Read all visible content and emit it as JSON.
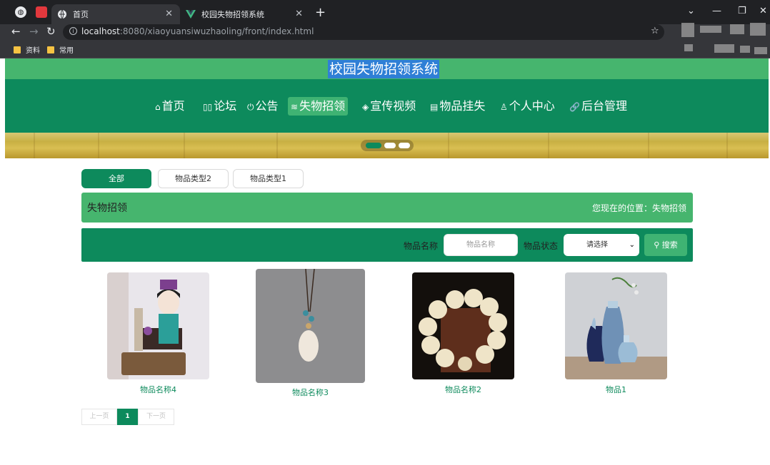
{
  "browser": {
    "tabs": [
      {
        "title": "首页",
        "active": true
      },
      {
        "title": "校园失物招领系统",
        "active": false
      }
    ],
    "url_host": "localhost",
    "url_rest": ":8080/xiaoyuansiwuzhaoling/front/index.html",
    "bookmarks": [
      "资料",
      "常用"
    ]
  },
  "site": {
    "title": "校园失物招领系统",
    "nav": [
      {
        "icon": "⌂",
        "label": "首页"
      },
      {
        "icon": "▯▯",
        "label": "论坛"
      },
      {
        "icon": "⏻",
        "label": "公告"
      },
      {
        "icon": "≋",
        "label": "失物招领"
      },
      {
        "icon": "◈",
        "label": "宣传视频"
      },
      {
        "icon": "▤",
        "label": "物品挂失"
      },
      {
        "icon": "♙",
        "label": "个人中心"
      },
      {
        "icon": "🔗",
        "label": "后台管理"
      }
    ],
    "active_nav": "失物招领"
  },
  "categories": [
    "全部",
    "物品类型2",
    "物品类型1"
  ],
  "breadcrumb": {
    "title": "失物招领",
    "position": "您现在的位置：失物招领"
  },
  "search": {
    "name_label": "物品名称",
    "name_placeholder": "物品名称",
    "status_label": "物品状态",
    "status_value": "请选择",
    "button_label": "搜索"
  },
  "items": [
    {
      "name": "物品名称4"
    },
    {
      "name": "物品名称3"
    },
    {
      "name": "物品名称2"
    },
    {
      "name": "物品1"
    }
  ],
  "pagination": {
    "prev": "上一页",
    "current": "1",
    "next": "下一页"
  },
  "colors": {
    "primary": "#0d8a5c",
    "accent": "#46b56e"
  }
}
